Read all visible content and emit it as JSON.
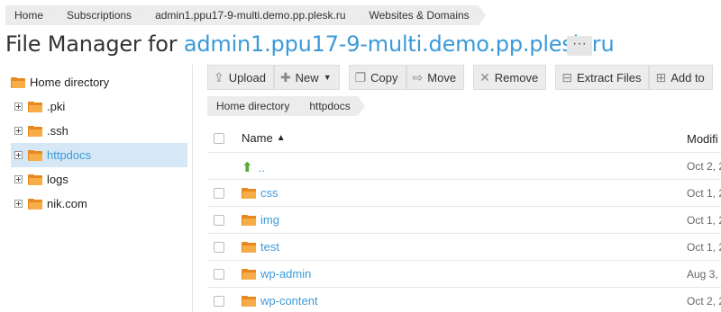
{
  "breadcrumb": [
    "Home",
    "Subscriptions",
    "admin1.ppu17-9-multi.demo.pp.plesk.ru",
    "Websites & Domains"
  ],
  "title": {
    "prefix": "File Manager for ",
    "domain": "admin1.ppu17-9-multi.demo.pp.plesk.ru",
    "more": "···"
  },
  "tree": {
    "root": "Home directory",
    "items": [
      ".pki",
      ".ssh",
      "httpdocs",
      "logs",
      "nik.com"
    ],
    "selected": "httpdocs"
  },
  "toolbar": {
    "upload": "Upload",
    "new": "New",
    "copy": "Copy",
    "move": "Move",
    "remove": "Remove",
    "extract": "Extract Files",
    "add_to": "Add to"
  },
  "path": [
    "Home directory",
    "httpdocs"
  ],
  "table": {
    "col_name": "Name",
    "col_modified": "Modifi",
    "up_label": "..",
    "up_modified": "Oct 2, 2",
    "rows": [
      {
        "name": "css",
        "modified": "Oct 1, 2"
      },
      {
        "name": "img",
        "modified": "Oct 1, 2"
      },
      {
        "name": "test",
        "modified": "Oct 1, 2"
      },
      {
        "name": "wp-admin",
        "modified": "Aug 3, 2"
      },
      {
        "name": "wp-content",
        "modified": "Oct 2, 2"
      }
    ]
  },
  "colors": {
    "link": "#3b9ad9",
    "selected": "#d6e8f5",
    "folder": "#f6ad48"
  }
}
